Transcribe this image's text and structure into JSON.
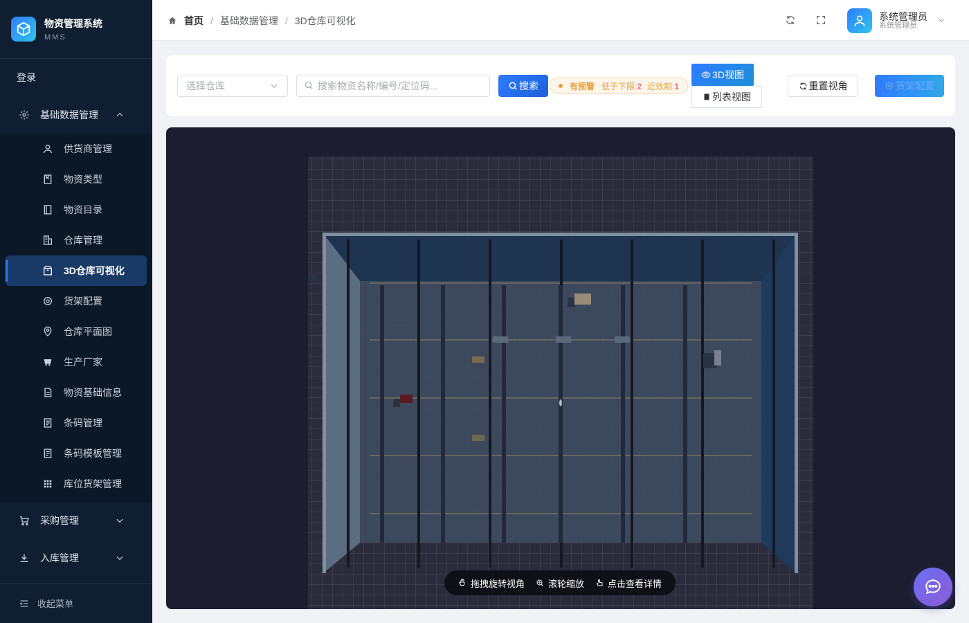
{
  "app": {
    "title": "物资管理系统",
    "subtitle": "MMS"
  },
  "sidebar": {
    "login": "登录",
    "group_basic": "基础数据管理",
    "items": [
      {
        "label": "供货商管理",
        "icon": "user-icon"
      },
      {
        "label": "物资类型",
        "icon": "book-icon"
      },
      {
        "label": "物资目录",
        "icon": "notebook-icon"
      },
      {
        "label": "仓库管理",
        "icon": "building-icon"
      },
      {
        "label": "3D仓库可视化",
        "icon": "box-icon",
        "active": true
      },
      {
        "label": "货架配置",
        "icon": "gear-icon"
      },
      {
        "label": "仓库平面图",
        "icon": "location-icon"
      },
      {
        "label": "生产厂家",
        "icon": "factory-icon"
      },
      {
        "label": "物资基础信息",
        "icon": "document-icon"
      },
      {
        "label": "条码管理",
        "icon": "tickets-icon"
      },
      {
        "label": "条码模板管理",
        "icon": "tickets-icon"
      },
      {
        "label": "库位货架管理",
        "icon": "grid-icon"
      }
    ],
    "group_purchase": "采购管理",
    "group_inbound": "入库管理",
    "collapse": "收起菜单"
  },
  "breadcrumb": {
    "home": "首页",
    "level1": "基础数据管理",
    "level2": "3D仓库可视化",
    "separator": "/"
  },
  "user": {
    "name": "系统管理员",
    "role": "系统管理员"
  },
  "toolbar": {
    "warehouse_placeholder": "选择仓库",
    "search_placeholder": "搜索物资名称/编号/定位码...",
    "search_label": "搜索",
    "warning_label": "有预警",
    "warning_low_prefix": "低于下限:",
    "warning_low_count": "2",
    "warning_expiry_prefix": "近效期:",
    "warning_expiry_count": "1",
    "view_3d": "3D视图",
    "view_list": "列表视图",
    "reset_view": "重置视角",
    "shelf_config": "货架配置"
  },
  "canvas": {
    "hints": [
      "拖拽旋转视角",
      "滚轮缩放",
      "点击查看详情"
    ],
    "background": "#1c1d2e"
  },
  "colors": {
    "accent": "#2f7bff",
    "sidebar_bg": "#0f1f31",
    "warning": "#e6a23c",
    "danger": "#f56c6c"
  }
}
